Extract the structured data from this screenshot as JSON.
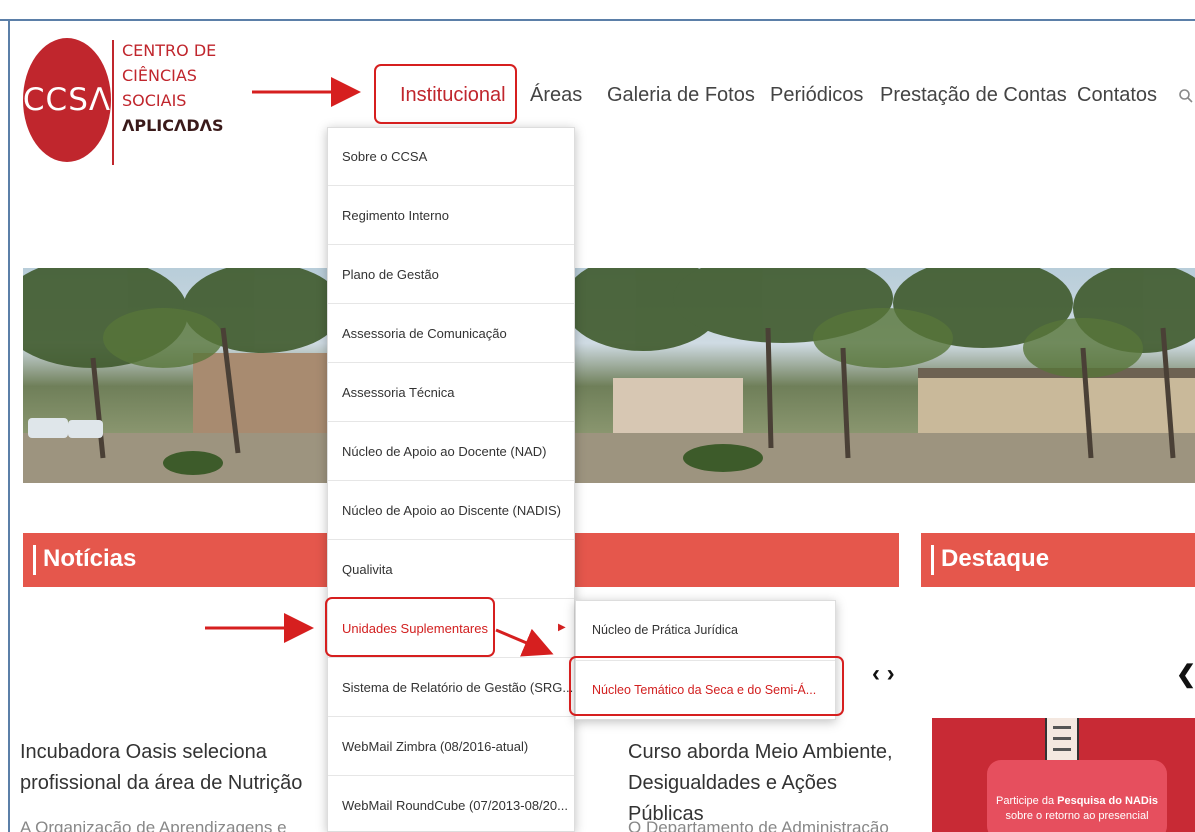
{
  "logo": {
    "mark": "CCSΛ",
    "lines": [
      "CENTRO DE",
      "CIÊNCIAS",
      "SOCIAIS",
      "ΛPLICΛDΛS"
    ]
  },
  "nav": {
    "items": [
      "Institucional",
      "Áreas",
      "Galeria de Fotos",
      "Periódicos",
      "Prestação de Contas",
      "Contatos"
    ],
    "search_icon": "search-icon"
  },
  "dropdown": {
    "items": [
      "Sobre o CCSA",
      "Regimento Interno",
      "Plano de Gestão",
      "Assessoria de Comunicação",
      "Assessoria Técnica",
      "Núcleo de Apoio ao Docente (NAD)",
      "Núcleo de Apoio ao Discente (NADIS)",
      "Qualivita",
      "Unidades Suplementares",
      "Sistema de Relatório de Gestão (SRG...",
      "WebMail Zimbra (08/2016-atual)",
      "WebMail RoundCube (07/2013-08/20..."
    ],
    "highlighted": "Unidades Suplementares"
  },
  "submenu": {
    "items": [
      "Núcleo de Prática Jurídica",
      "Núcleo Temático da Seca e do Semi-Á..."
    ],
    "highlighted": "Núcleo Temático da Seca e do Semi-Á..."
  },
  "sections": {
    "news": "Notícias",
    "highlight": "Destaque"
  },
  "carousel": {
    "prev": "❮",
    "next": "❯",
    "pair": "‹ ›"
  },
  "news": [
    {
      "title": "Incubadora Oasis seleciona profissional da área de Nutrição",
      "excerpt": "A Organização de Aprendizagens e"
    },
    {
      "title": "Curso aborda Meio Ambiente, Desigualdades e Ações Públicas",
      "excerpt": "O Departamento de Administração"
    }
  ],
  "promo": {
    "line1": "Participe da",
    "bold": "Pesquisa do NADis",
    "line2": "sobre o retorno ao presencial"
  },
  "colors": {
    "brand_red": "#c0262d",
    "section_red": "#e5574c",
    "annotation_red": "#d61f1f"
  }
}
